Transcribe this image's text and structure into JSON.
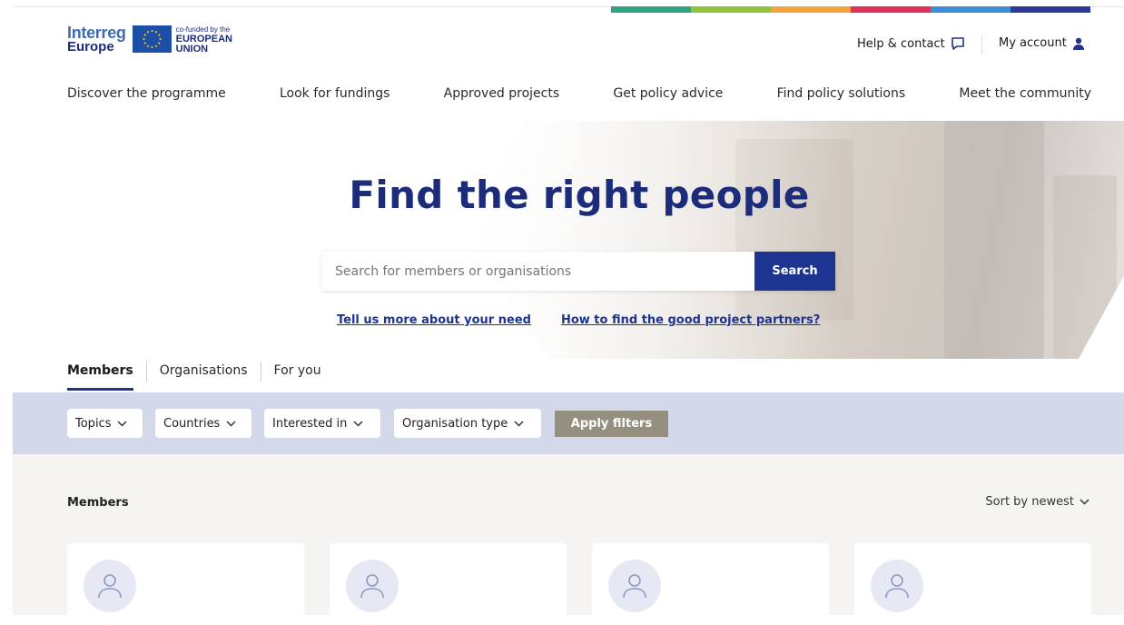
{
  "colors": {
    "brand_blue": "#1d2c7a",
    "button_blue": "#1d3591",
    "filter_bar": "#d3d9ea",
    "apply_button": "#948f7f",
    "list_bg": "#f6f4f2",
    "stripe": [
      "#2fa27f",
      "#8fc23f",
      "#f2a33a",
      "#e1305a",
      "#3a8fd8",
      "#2a3a9a"
    ]
  },
  "logo": {
    "line1": "Interreg",
    "line2": "Europe",
    "eu_small": "co-funded by the",
    "eu_line1": "EUROPEAN",
    "eu_line2": "UNION"
  },
  "header": {
    "help_label": "Help & contact",
    "account_label": "My account"
  },
  "nav": {
    "items": [
      "Discover the programme",
      "Look for fundings",
      "Approved projects",
      "Get policy advice",
      "Find policy solutions",
      "Meet the community"
    ]
  },
  "hero": {
    "title": "Find the right people",
    "search_placeholder": "Search for members or organisations",
    "search_button": "Search",
    "link1": "Tell us more about your need",
    "link2": "How to find the good project partners?"
  },
  "tabs": [
    "Members",
    "Organisations",
    "For you"
  ],
  "filters": {
    "items": [
      "Topics",
      "Countries",
      "Interested in",
      "Organisation type"
    ],
    "apply": "Apply filters"
  },
  "list": {
    "title": "Members",
    "sort": "Sort by newest"
  }
}
